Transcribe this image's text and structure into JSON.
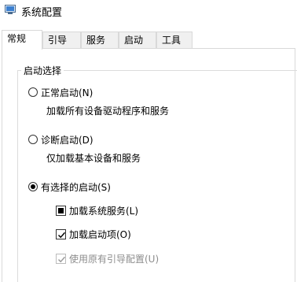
{
  "window": {
    "title": "系统配置",
    "app_icon": "system-config-icon"
  },
  "tabs": [
    {
      "label": "常规",
      "active": true
    },
    {
      "label": "引导",
      "active": false
    },
    {
      "label": "服务",
      "active": false
    },
    {
      "label": "启动",
      "active": false
    },
    {
      "label": "工具",
      "active": false
    }
  ],
  "startup_selection": {
    "group_label": "启动选择",
    "normal": {
      "label": "正常启动(N)",
      "description": "加载所有设备驱动程序和服务",
      "checked": false
    },
    "diagnostic": {
      "label": "诊断启动(D)",
      "description": "仅加载基本设备和服务",
      "checked": false
    },
    "selective": {
      "label": "有选择的启动(S)",
      "checked": true,
      "options": {
        "load_system_services": {
          "label": "加载系统服务(L)",
          "state": "indeterminate"
        },
        "load_startup_items": {
          "label": "加载启动项(O)",
          "state": "checked"
        },
        "use_original_boot_config": {
          "label": "使用原有引导配置(U)",
          "state": "checked",
          "disabled": true
        }
      }
    }
  },
  "colors": {
    "border": "#d9d9d9",
    "tab_inactive_bg": "#f0f0f0",
    "disabled_text": "#8d8d8d"
  }
}
